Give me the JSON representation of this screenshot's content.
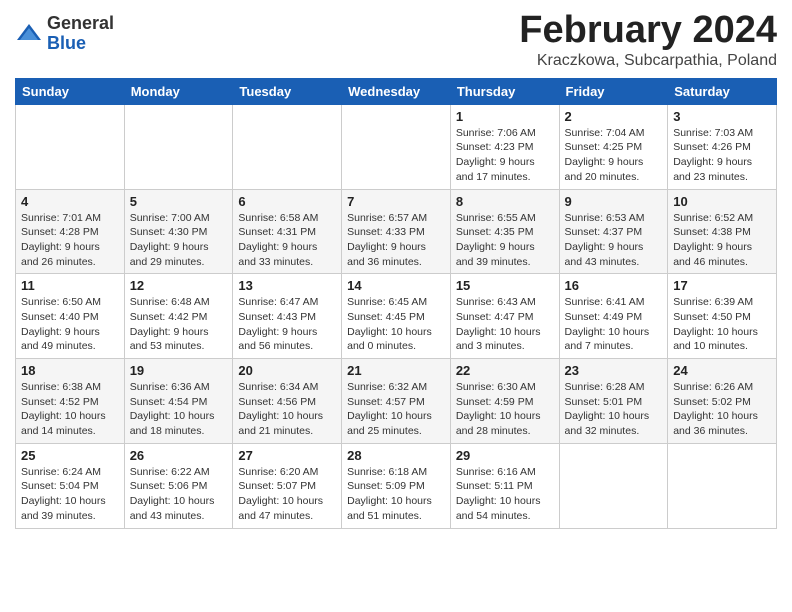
{
  "logo": {
    "general": "General",
    "blue": "Blue"
  },
  "header": {
    "month": "February 2024",
    "location": "Kraczkowa, Subcarpathia, Poland"
  },
  "weekdays": [
    "Sunday",
    "Monday",
    "Tuesday",
    "Wednesday",
    "Thursday",
    "Friday",
    "Saturday"
  ],
  "weeks": [
    [
      {
        "day": "",
        "info": ""
      },
      {
        "day": "",
        "info": ""
      },
      {
        "day": "",
        "info": ""
      },
      {
        "day": "",
        "info": ""
      },
      {
        "day": "1",
        "info": "Sunrise: 7:06 AM\nSunset: 4:23 PM\nDaylight: 9 hours\nand 17 minutes."
      },
      {
        "day": "2",
        "info": "Sunrise: 7:04 AM\nSunset: 4:25 PM\nDaylight: 9 hours\nand 20 minutes."
      },
      {
        "day": "3",
        "info": "Sunrise: 7:03 AM\nSunset: 4:26 PM\nDaylight: 9 hours\nand 23 minutes."
      }
    ],
    [
      {
        "day": "4",
        "info": "Sunrise: 7:01 AM\nSunset: 4:28 PM\nDaylight: 9 hours\nand 26 minutes."
      },
      {
        "day": "5",
        "info": "Sunrise: 7:00 AM\nSunset: 4:30 PM\nDaylight: 9 hours\nand 29 minutes."
      },
      {
        "day": "6",
        "info": "Sunrise: 6:58 AM\nSunset: 4:31 PM\nDaylight: 9 hours\nand 33 minutes."
      },
      {
        "day": "7",
        "info": "Sunrise: 6:57 AM\nSunset: 4:33 PM\nDaylight: 9 hours\nand 36 minutes."
      },
      {
        "day": "8",
        "info": "Sunrise: 6:55 AM\nSunset: 4:35 PM\nDaylight: 9 hours\nand 39 minutes."
      },
      {
        "day": "9",
        "info": "Sunrise: 6:53 AM\nSunset: 4:37 PM\nDaylight: 9 hours\nand 43 minutes."
      },
      {
        "day": "10",
        "info": "Sunrise: 6:52 AM\nSunset: 4:38 PM\nDaylight: 9 hours\nand 46 minutes."
      }
    ],
    [
      {
        "day": "11",
        "info": "Sunrise: 6:50 AM\nSunset: 4:40 PM\nDaylight: 9 hours\nand 49 minutes."
      },
      {
        "day": "12",
        "info": "Sunrise: 6:48 AM\nSunset: 4:42 PM\nDaylight: 9 hours\nand 53 minutes."
      },
      {
        "day": "13",
        "info": "Sunrise: 6:47 AM\nSunset: 4:43 PM\nDaylight: 9 hours\nand 56 minutes."
      },
      {
        "day": "14",
        "info": "Sunrise: 6:45 AM\nSunset: 4:45 PM\nDaylight: 10 hours\nand 0 minutes."
      },
      {
        "day": "15",
        "info": "Sunrise: 6:43 AM\nSunset: 4:47 PM\nDaylight: 10 hours\nand 3 minutes."
      },
      {
        "day": "16",
        "info": "Sunrise: 6:41 AM\nSunset: 4:49 PM\nDaylight: 10 hours\nand 7 minutes."
      },
      {
        "day": "17",
        "info": "Sunrise: 6:39 AM\nSunset: 4:50 PM\nDaylight: 10 hours\nand 10 minutes."
      }
    ],
    [
      {
        "day": "18",
        "info": "Sunrise: 6:38 AM\nSunset: 4:52 PM\nDaylight: 10 hours\nand 14 minutes."
      },
      {
        "day": "19",
        "info": "Sunrise: 6:36 AM\nSunset: 4:54 PM\nDaylight: 10 hours\nand 18 minutes."
      },
      {
        "day": "20",
        "info": "Sunrise: 6:34 AM\nSunset: 4:56 PM\nDaylight: 10 hours\nand 21 minutes."
      },
      {
        "day": "21",
        "info": "Sunrise: 6:32 AM\nSunset: 4:57 PM\nDaylight: 10 hours\nand 25 minutes."
      },
      {
        "day": "22",
        "info": "Sunrise: 6:30 AM\nSunset: 4:59 PM\nDaylight: 10 hours\nand 28 minutes."
      },
      {
        "day": "23",
        "info": "Sunrise: 6:28 AM\nSunset: 5:01 PM\nDaylight: 10 hours\nand 32 minutes."
      },
      {
        "day": "24",
        "info": "Sunrise: 6:26 AM\nSunset: 5:02 PM\nDaylight: 10 hours\nand 36 minutes."
      }
    ],
    [
      {
        "day": "25",
        "info": "Sunrise: 6:24 AM\nSunset: 5:04 PM\nDaylight: 10 hours\nand 39 minutes."
      },
      {
        "day": "26",
        "info": "Sunrise: 6:22 AM\nSunset: 5:06 PM\nDaylight: 10 hours\nand 43 minutes."
      },
      {
        "day": "27",
        "info": "Sunrise: 6:20 AM\nSunset: 5:07 PM\nDaylight: 10 hours\nand 47 minutes."
      },
      {
        "day": "28",
        "info": "Sunrise: 6:18 AM\nSunset: 5:09 PM\nDaylight: 10 hours\nand 51 minutes."
      },
      {
        "day": "29",
        "info": "Sunrise: 6:16 AM\nSunset: 5:11 PM\nDaylight: 10 hours\nand 54 minutes."
      },
      {
        "day": "",
        "info": ""
      },
      {
        "day": "",
        "info": ""
      }
    ]
  ]
}
